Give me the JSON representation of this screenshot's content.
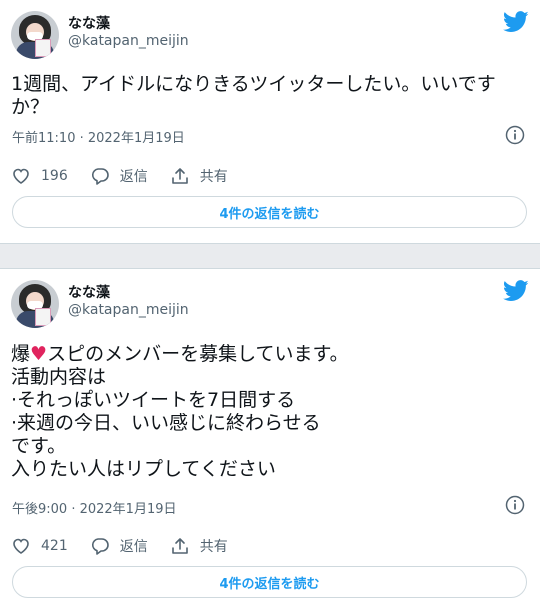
{
  "colors": {
    "accent": "#1d9bf0",
    "heart": "#e0245e",
    "muted": "#536471"
  },
  "tweets": [
    {
      "author": "なな藻",
      "handle": "@katapan_meijin",
      "text": "1週間、アイドルになりきるツイッターしたい。いいですか？",
      "timestamp": "午前11:10 · 2022年1月19日",
      "likes": "196",
      "reply_label": "返信",
      "share_label": "共有",
      "read_replies": "4件の返信を読む"
    },
    {
      "author": "なな藻",
      "handle": "@katapan_meijin",
      "text_before_heart": "爆",
      "heart": "♥",
      "text_after_heart": "スピのメンバーを募集しています。\n活動内容は\n·それっぽいツイートを7日間する\n·来週の今日、いい感じに終わらせる\nです。\n入りたい人はリプしてください",
      "timestamp": "午後9:00 · 2022年1月19日",
      "likes": "421",
      "reply_label": "返信",
      "share_label": "共有",
      "read_replies": "4件の返信を読む"
    }
  ]
}
